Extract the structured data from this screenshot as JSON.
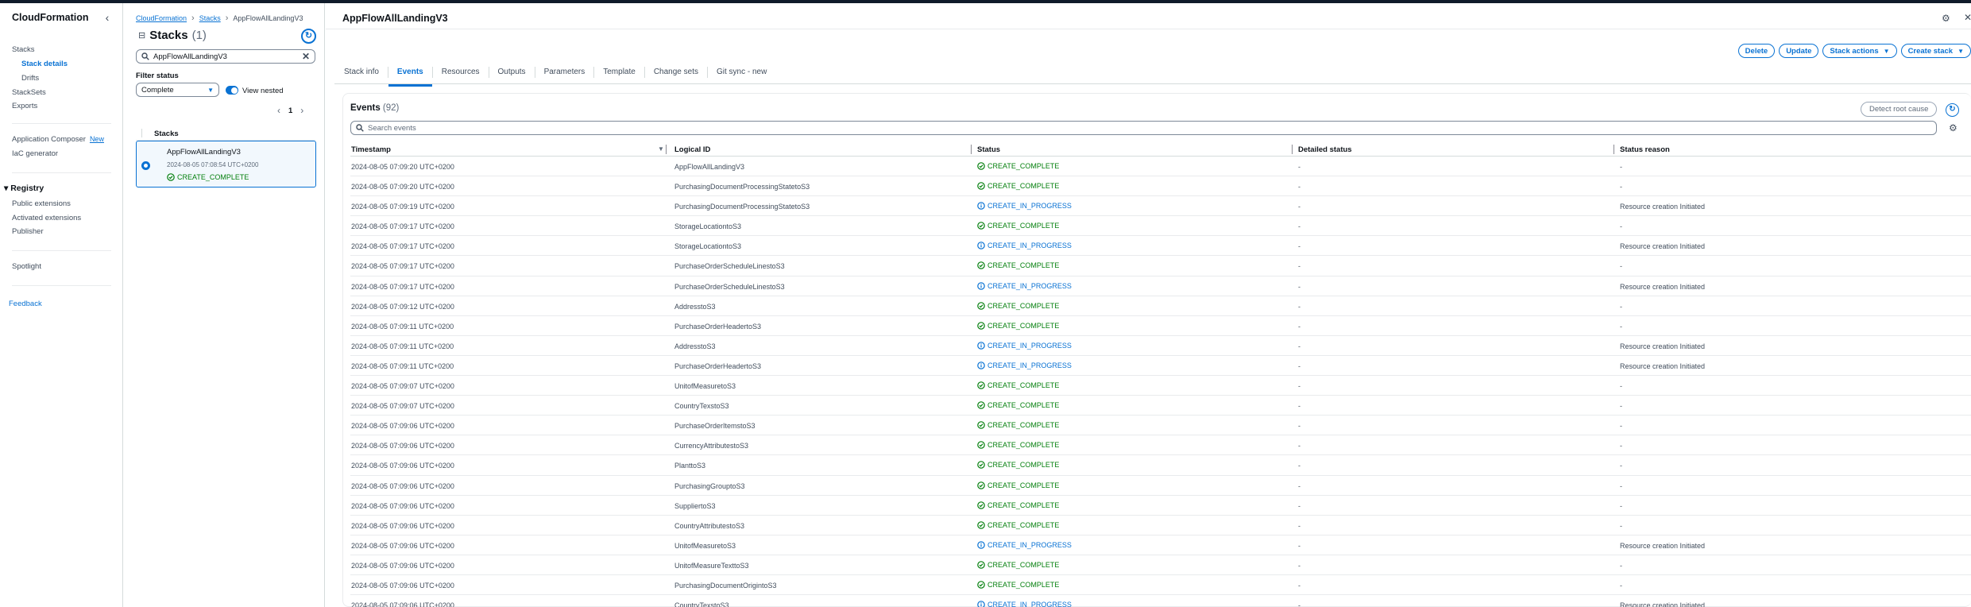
{
  "colors": {
    "accent": "#0972d3",
    "success": "#037f0c",
    "text": "#0f141a",
    "muted": "#414d5c"
  },
  "nav": {
    "title": "CloudFormation",
    "items": [
      {
        "label": "Stacks"
      },
      {
        "label": "Stack details"
      },
      {
        "label": "Drifts"
      },
      {
        "label": "StackSets"
      },
      {
        "label": "Exports"
      }
    ],
    "app_composer": "Application Composer",
    "new_badge": "New",
    "iac_generator": "IaC generator",
    "registry": "Registry",
    "registry_items": [
      "Public extensions",
      "Activated extensions",
      "Publisher"
    ],
    "spotlight": "Spotlight",
    "feedback": "Feedback"
  },
  "stacks_panel": {
    "breadcrumb": [
      "CloudFormation",
      "Stacks",
      "AppFlowAllLandingV3"
    ],
    "title": "Stacks",
    "count": "(1)",
    "search_value": "AppFlowAllLandingV3",
    "filter_label": "Filter status",
    "filter_value": "Complete",
    "view_nested": "View nested",
    "page": "1",
    "list_header": "Stacks",
    "stack": {
      "name": "AppFlowAllLandingV3",
      "date": "2024-08-05 07:08:54 UTC+0200",
      "status": "CREATE_COMPLETE"
    }
  },
  "main": {
    "title": "AppFlowAllLandingV3",
    "actions": {
      "delete": "Delete",
      "update": "Update",
      "stack_actions": "Stack actions",
      "create_stack": "Create stack"
    },
    "tabs": [
      "Stack info",
      "Events",
      "Resources",
      "Outputs",
      "Parameters",
      "Template",
      "Change sets",
      "Git sync - new"
    ],
    "active_tab": "Events"
  },
  "events": {
    "title": "Events",
    "count": "(92)",
    "detect_root_cause": "Detect root cause",
    "search_placeholder": "Search events",
    "columns": [
      "Timestamp",
      "Logical ID",
      "Status",
      "Detailed status",
      "Status reason"
    ],
    "rows": [
      {
        "ts": "2024-08-05 07:09:20 UTC+0200",
        "lid": "AppFlowAllLandingV3",
        "status": "CREATE_COMPLETE",
        "detailed": "-",
        "reason": "-"
      },
      {
        "ts": "2024-08-05 07:09:20 UTC+0200",
        "lid": "PurchasingDocumentProcessingStatetoS3",
        "status": "CREATE_COMPLETE",
        "detailed": "-",
        "reason": "-"
      },
      {
        "ts": "2024-08-05 07:09:19 UTC+0200",
        "lid": "PurchasingDocumentProcessingStatetoS3",
        "status": "CREATE_IN_PROGRESS",
        "detailed": "-",
        "reason": "Resource creation Initiated"
      },
      {
        "ts": "2024-08-05 07:09:17 UTC+0200",
        "lid": "StorageLocationtoS3",
        "status": "CREATE_COMPLETE",
        "detailed": "-",
        "reason": "-"
      },
      {
        "ts": "2024-08-05 07:09:17 UTC+0200",
        "lid": "StorageLocationtoS3",
        "status": "CREATE_IN_PROGRESS",
        "detailed": "-",
        "reason": "Resource creation Initiated"
      },
      {
        "ts": "2024-08-05 07:09:17 UTC+0200",
        "lid": "PurchaseOrderScheduleLinestoS3",
        "status": "CREATE_COMPLETE",
        "detailed": "-",
        "reason": "-"
      },
      {
        "ts": "2024-08-05 07:09:17 UTC+0200",
        "lid": "PurchaseOrderScheduleLinestoS3",
        "status": "CREATE_IN_PROGRESS",
        "detailed": "-",
        "reason": "Resource creation Initiated"
      },
      {
        "ts": "2024-08-05 07:09:12 UTC+0200",
        "lid": "AddresstoS3",
        "status": "CREATE_COMPLETE",
        "detailed": "-",
        "reason": "-"
      },
      {
        "ts": "2024-08-05 07:09:11 UTC+0200",
        "lid": "PurchaseOrderHeadertoS3",
        "status": "CREATE_COMPLETE",
        "detailed": "-",
        "reason": "-"
      },
      {
        "ts": "2024-08-05 07:09:11 UTC+0200",
        "lid": "AddresstoS3",
        "status": "CREATE_IN_PROGRESS",
        "detailed": "-",
        "reason": "Resource creation Initiated"
      },
      {
        "ts": "2024-08-05 07:09:11 UTC+0200",
        "lid": "PurchaseOrderHeadertoS3",
        "status": "CREATE_IN_PROGRESS",
        "detailed": "-",
        "reason": "Resource creation Initiated"
      },
      {
        "ts": "2024-08-05 07:09:07 UTC+0200",
        "lid": "UnitofMeasuretoS3",
        "status": "CREATE_COMPLETE",
        "detailed": "-",
        "reason": "-"
      },
      {
        "ts": "2024-08-05 07:09:07 UTC+0200",
        "lid": "CountryTexstoS3",
        "status": "CREATE_COMPLETE",
        "detailed": "-",
        "reason": "-"
      },
      {
        "ts": "2024-08-05 07:09:06 UTC+0200",
        "lid": "PurchaseOrderItemstoS3",
        "status": "CREATE_COMPLETE",
        "detailed": "-",
        "reason": "-"
      },
      {
        "ts": "2024-08-05 07:09:06 UTC+0200",
        "lid": "CurrencyAttributestoS3",
        "status": "CREATE_COMPLETE",
        "detailed": "-",
        "reason": "-"
      },
      {
        "ts": "2024-08-05 07:09:06 UTC+0200",
        "lid": "PlanttoS3",
        "status": "CREATE_COMPLETE",
        "detailed": "-",
        "reason": "-"
      },
      {
        "ts": "2024-08-05 07:09:06 UTC+0200",
        "lid": "PurchasingGrouptoS3",
        "status": "CREATE_COMPLETE",
        "detailed": "-",
        "reason": "-"
      },
      {
        "ts": "2024-08-05 07:09:06 UTC+0200",
        "lid": "SuppliertoS3",
        "status": "CREATE_COMPLETE",
        "detailed": "-",
        "reason": "-"
      },
      {
        "ts": "2024-08-05 07:09:06 UTC+0200",
        "lid": "CountryAttributestoS3",
        "status": "CREATE_COMPLETE",
        "detailed": "-",
        "reason": "-"
      },
      {
        "ts": "2024-08-05 07:09:06 UTC+0200",
        "lid": "UnitofMeasuretoS3",
        "status": "CREATE_IN_PROGRESS",
        "detailed": "-",
        "reason": "Resource creation Initiated"
      },
      {
        "ts": "2024-08-05 07:09:06 UTC+0200",
        "lid": "UnitofMeasureTexttoS3",
        "status": "CREATE_COMPLETE",
        "detailed": "-",
        "reason": "-"
      },
      {
        "ts": "2024-08-05 07:09:06 UTC+0200",
        "lid": "PurchasingDocumentOrigintoS3",
        "status": "CREATE_COMPLETE",
        "detailed": "-",
        "reason": "-"
      },
      {
        "ts": "2024-08-05 07:09:06 UTC+0200",
        "lid": "CountryTexstoS3",
        "status": "CREATE_IN_PROGRESS",
        "detailed": "-",
        "reason": "Resource creation Initiated"
      }
    ]
  }
}
